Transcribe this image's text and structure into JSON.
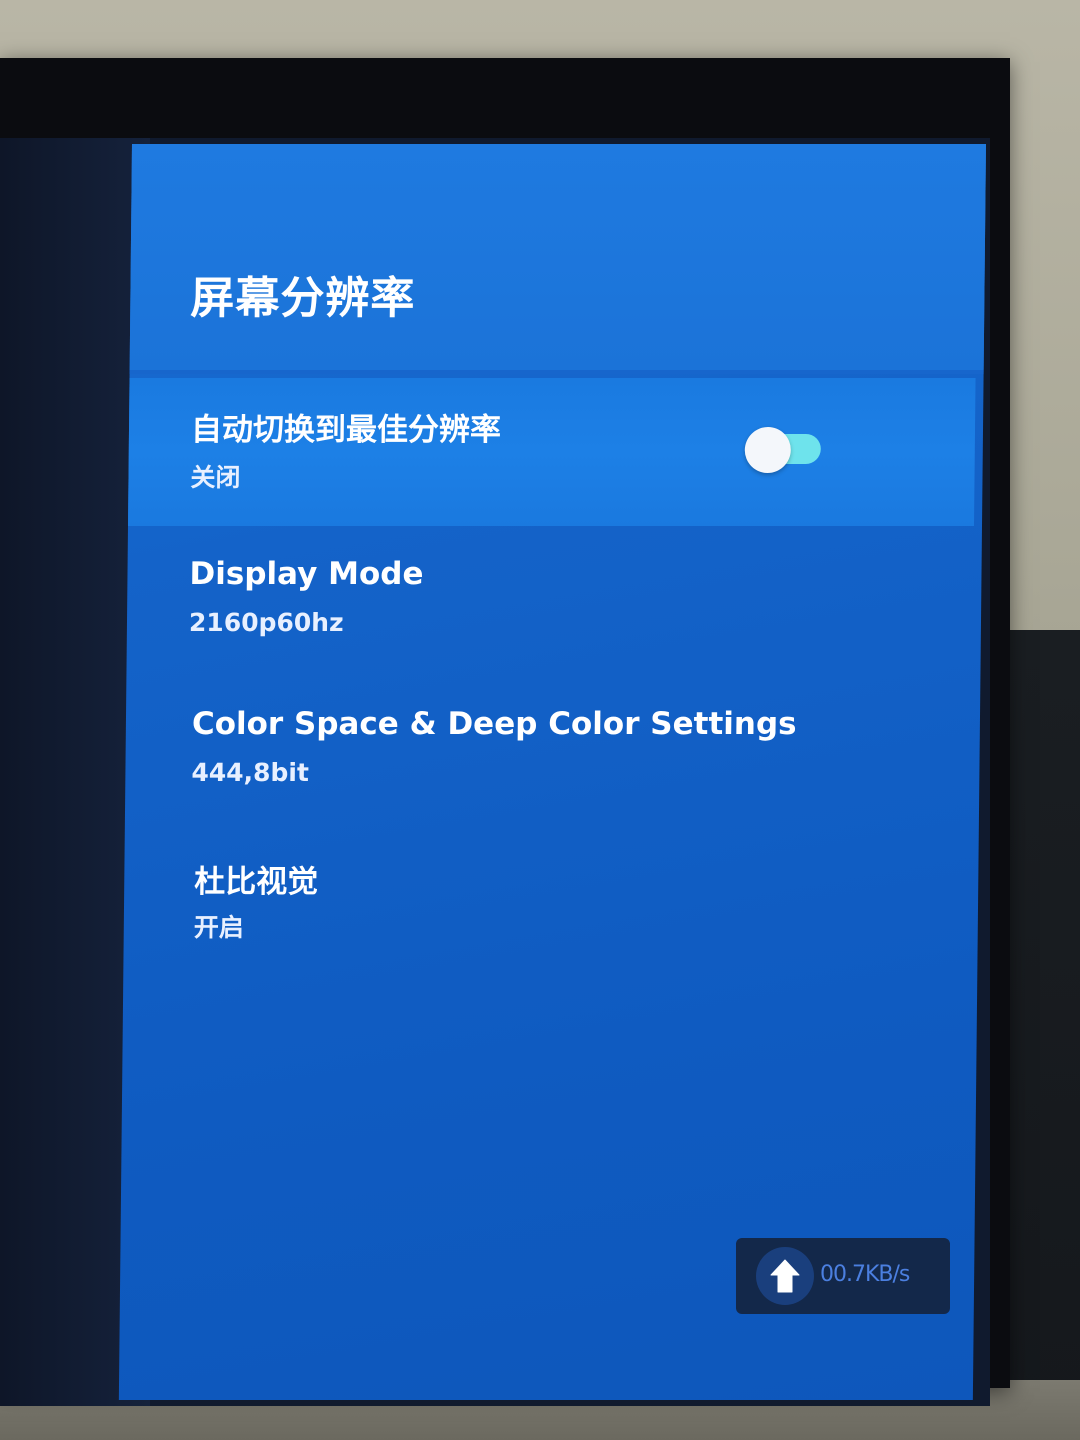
{
  "panel": {
    "title": "屏幕分辨率"
  },
  "settings": [
    {
      "title": "自动切换到最佳分辨率",
      "value": "关闭",
      "toggle": "off"
    },
    {
      "title": "Display Mode",
      "value": "2160p60hz"
    },
    {
      "title": "Color Space & Deep Color Settings",
      "value": "444,8bit"
    },
    {
      "title": "杜比视觉",
      "value": "开启"
    }
  ],
  "speed_widget": {
    "icon": "arrow-up-icon",
    "text": "00.7KB/s"
  },
  "colors": {
    "panel_blue": "#1463c9",
    "selected_row": "#1d80e6",
    "toggle_track": "#6ee3ec",
    "speed_text": "#4b7fe0"
  }
}
